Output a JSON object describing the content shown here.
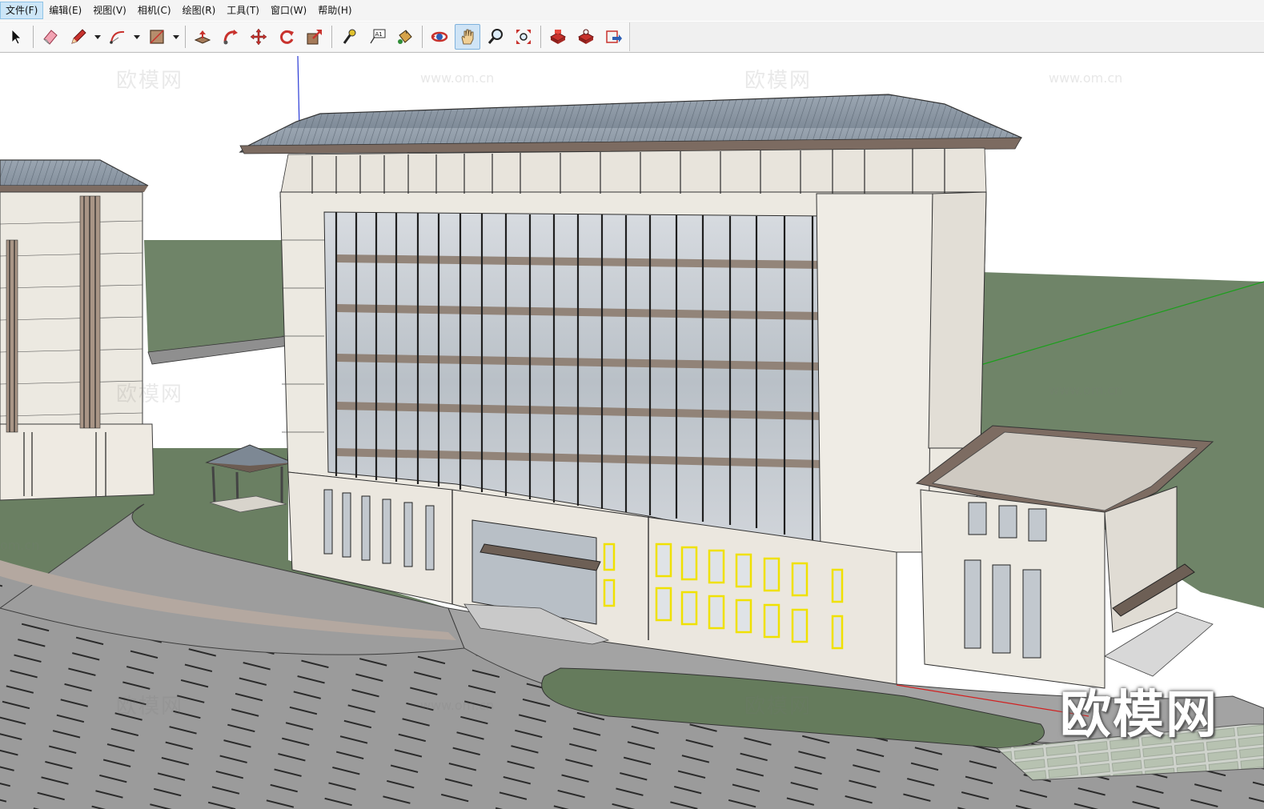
{
  "menubar": {
    "items": [
      {
        "label": "文件(F)",
        "active": true
      },
      {
        "label": "编辑(E)"
      },
      {
        "label": "视图(V)"
      },
      {
        "label": "相机(C)"
      },
      {
        "label": "绘图(R)"
      },
      {
        "label": "工具(T)"
      },
      {
        "label": "窗口(W)"
      },
      {
        "label": "帮助(H)"
      }
    ]
  },
  "toolbar": {
    "tools": [
      {
        "name": "select-tool",
        "icon": "arrow-cursor-icon"
      },
      {
        "name": "eraser-tool",
        "icon": "eraser-icon"
      },
      {
        "name": "pencil-tool",
        "icon": "pencil-icon"
      },
      {
        "name": "arc-tool",
        "icon": "arc-icon"
      },
      {
        "name": "rectangle-tool",
        "icon": "rectangle-icon"
      },
      {
        "name": "push-pull-tool",
        "icon": "push-pull-icon"
      },
      {
        "name": "follow-me-tool",
        "icon": "follow-me-icon"
      },
      {
        "name": "move-tool",
        "icon": "move-icon"
      },
      {
        "name": "rotate-tool",
        "icon": "rotate-icon"
      },
      {
        "name": "scale-tool",
        "icon": "scale-icon"
      },
      {
        "name": "tape-measure-tool",
        "icon": "tape-measure-icon"
      },
      {
        "name": "text-tool",
        "icon": "text-label-icon",
        "text": "A1"
      },
      {
        "name": "paint-bucket-tool",
        "icon": "paint-bucket-icon"
      },
      {
        "name": "orbit-tool",
        "icon": "orbit-icon"
      },
      {
        "name": "pan-tool",
        "icon": "pan-hand-icon",
        "active": true
      },
      {
        "name": "zoom-tool",
        "icon": "zoom-icon"
      },
      {
        "name": "zoom-extents-tool",
        "icon": "zoom-extents-icon"
      },
      {
        "name": "warehouse-tool",
        "icon": "3d-warehouse-icon"
      },
      {
        "name": "extension-warehouse-tool",
        "icon": "extension-warehouse-icon"
      },
      {
        "name": "share-model-tool",
        "icon": "share-model-icon"
      }
    ]
  },
  "watermarks": {
    "text": "欧模网",
    "url": "www.om.cn",
    "url_short": "om.cn"
  },
  "logo": {
    "text": "欧模网"
  },
  "colors": {
    "menu_active": "#cde6f7",
    "ground_green": "#6b8063",
    "road": "#9a9a9a",
    "facade": "#ece9e1",
    "roof": "#8e99a6",
    "glass": "#c7cdd3",
    "mullion_brown": "#8a7a6e",
    "axis_blue": "#2a3bd6",
    "axis_green": "#1ba01b",
    "axis_red": "#d22020"
  }
}
